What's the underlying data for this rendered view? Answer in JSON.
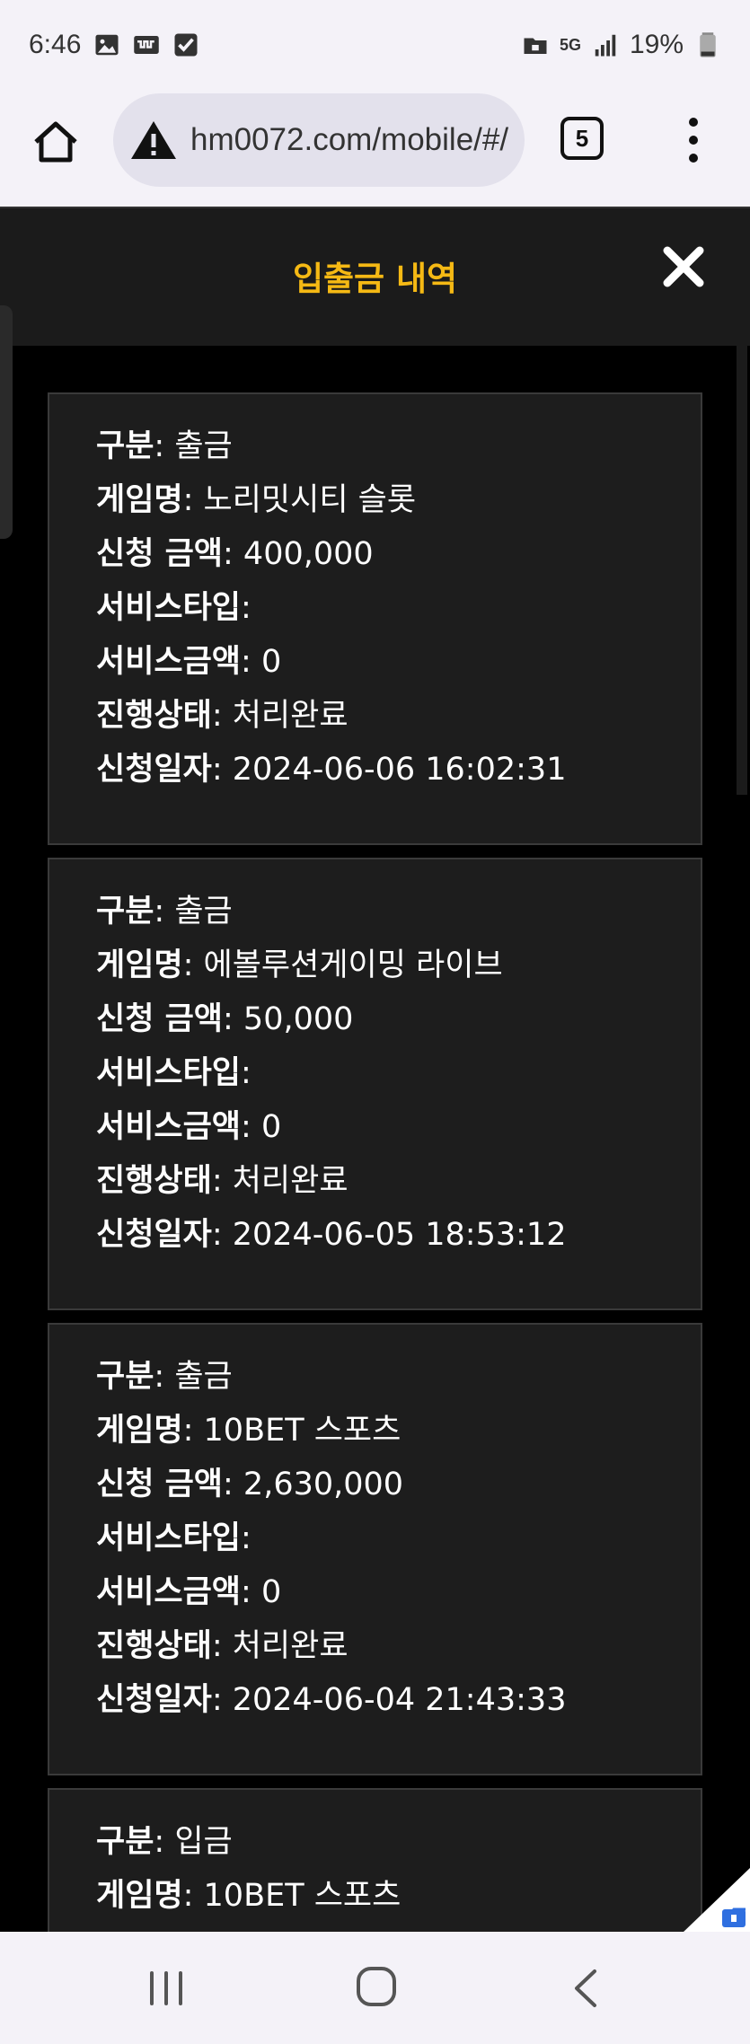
{
  "status_bar": {
    "time": "6:46",
    "network": "5G",
    "battery": "19%"
  },
  "browser": {
    "url": "hm0072.com/mobile/#/",
    "tab_count": "5"
  },
  "page": {
    "title": "입출금 내역"
  },
  "labels": {
    "type": "구분",
    "game": "게임명",
    "amount": "신청 금액",
    "service_type": "서비스타입",
    "service_amount": "서비스금액",
    "status": "진행상태",
    "date": "신청일자"
  },
  "records": [
    {
      "type": "출금",
      "game": "노리밋시티 슬롯",
      "amount": "400,000",
      "service_type": "",
      "service_amount": "0",
      "status": "처리완료",
      "date": "2024-06-06 16:02:31"
    },
    {
      "type": "출금",
      "game": "에볼루션게이밍 라이브",
      "amount": "50,000",
      "service_type": "",
      "service_amount": "0",
      "status": "처리완료",
      "date": "2024-06-05 18:53:12"
    },
    {
      "type": "출금",
      "game": "10BET 스포츠",
      "amount": "2,630,000",
      "service_type": "",
      "service_amount": "0",
      "status": "처리완료",
      "date": "2024-06-04 21:43:33"
    },
    {
      "type": "입금",
      "game": "10BET 스포츠"
    }
  ]
}
